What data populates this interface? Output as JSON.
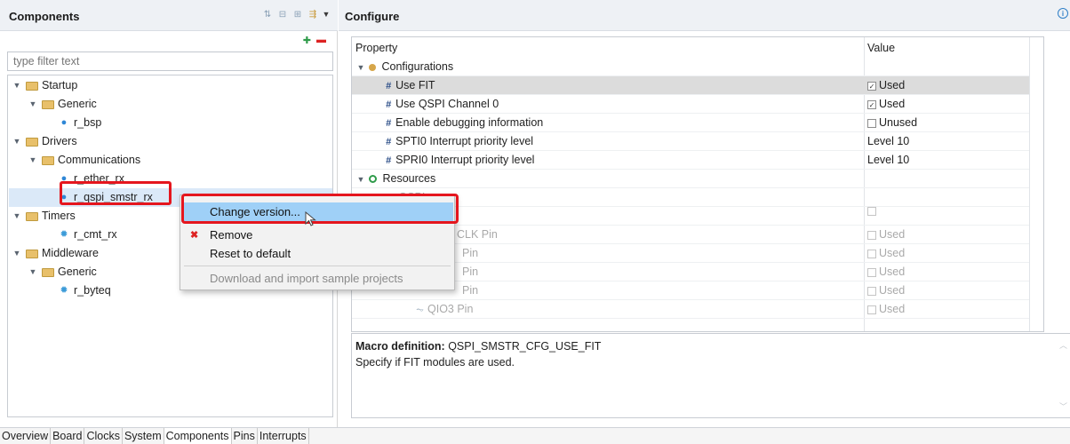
{
  "components_panel": {
    "title": "Components",
    "filter_placeholder": "type filter text",
    "tree": [
      {
        "label": "Startup",
        "kind": "folder"
      },
      {
        "label": "Generic",
        "kind": "folder"
      },
      {
        "label": "r_bsp",
        "kind": "component"
      },
      {
        "label": "Drivers",
        "kind": "folder"
      },
      {
        "label": "Communications",
        "kind": "folder"
      },
      {
        "label": "r_ether_rx",
        "kind": "component"
      },
      {
        "label": "r_qspi_smstr_rx",
        "kind": "component",
        "selected": true
      },
      {
        "label": "Timers",
        "kind": "folder"
      },
      {
        "label": "r_cmt_rx",
        "kind": "component"
      },
      {
        "label": "Middleware",
        "kind": "folder"
      },
      {
        "label": "Generic",
        "kind": "folder"
      },
      {
        "label": "r_byteq",
        "kind": "component"
      }
    ]
  },
  "context_menu": {
    "items": [
      {
        "label": "Change version...",
        "highlighted": true,
        "enabled": true
      },
      {
        "label": "Remove",
        "enabled": true,
        "icon": "remove-x-icon"
      },
      {
        "label": "Reset to default",
        "enabled": true
      },
      {
        "label": "Download and import sample projects",
        "enabled": false
      }
    ]
  },
  "configure_panel": {
    "title": "Configure",
    "columns": [
      "Property",
      "Value"
    ],
    "rows": [
      {
        "name": "Configurations",
        "level": 0,
        "type": "group",
        "value": ""
      },
      {
        "name": "Use FIT",
        "level": 1,
        "type": "prop",
        "value": "Used",
        "checked": true,
        "selected": true
      },
      {
        "name": "Use QSPI Channel 0",
        "level": 1,
        "type": "prop",
        "value": "Used",
        "checked": true
      },
      {
        "name": "Enable debugging information",
        "level": 1,
        "type": "prop",
        "value": "Unused",
        "checked": false
      },
      {
        "name": "SPTI0 Interrupt priority level",
        "level": 1,
        "type": "prop",
        "value": "Level 10"
      },
      {
        "name": "SPRI0 Interrupt priority level",
        "level": 1,
        "type": "prop",
        "value": "Level 10"
      },
      {
        "name": "Resources",
        "level": 0,
        "type": "group",
        "value": ""
      },
      {
        "name": "QSPI",
        "level": 1,
        "type": "group",
        "value": ""
      },
      {
        "name": "",
        "level": 2,
        "type": "pin",
        "value": ""
      },
      {
        "name": "CLK Pin",
        "level": 2,
        "type": "pin",
        "value": "Used"
      },
      {
        "name": "Pin",
        "level": 2,
        "type": "pin",
        "value": "Used"
      },
      {
        "name": "Pin",
        "level": 2,
        "type": "pin",
        "value": "Used"
      },
      {
        "name": "Pin",
        "level": 2,
        "type": "pin",
        "value": "Used"
      },
      {
        "name": "QIO3 Pin",
        "level": 2,
        "type": "pin",
        "value": "Used"
      }
    ],
    "description": {
      "label": "Macro definition:",
      "macro": "QSPI_SMSTR_CFG_USE_FIT",
      "text": "Specify if FIT modules are used."
    }
  },
  "bottom_tabs": [
    "Overview",
    "Board",
    "Clocks",
    "System",
    "Components",
    "Pins",
    "Interrupts"
  ],
  "active_tab": "Components",
  "colors": {
    "header_bg": "#eef1f5",
    "selection": "#dbe9f8",
    "menu_highlight": "#9fd0f7",
    "annotation_red": "#e5161e",
    "folder": "#e8c06a"
  }
}
